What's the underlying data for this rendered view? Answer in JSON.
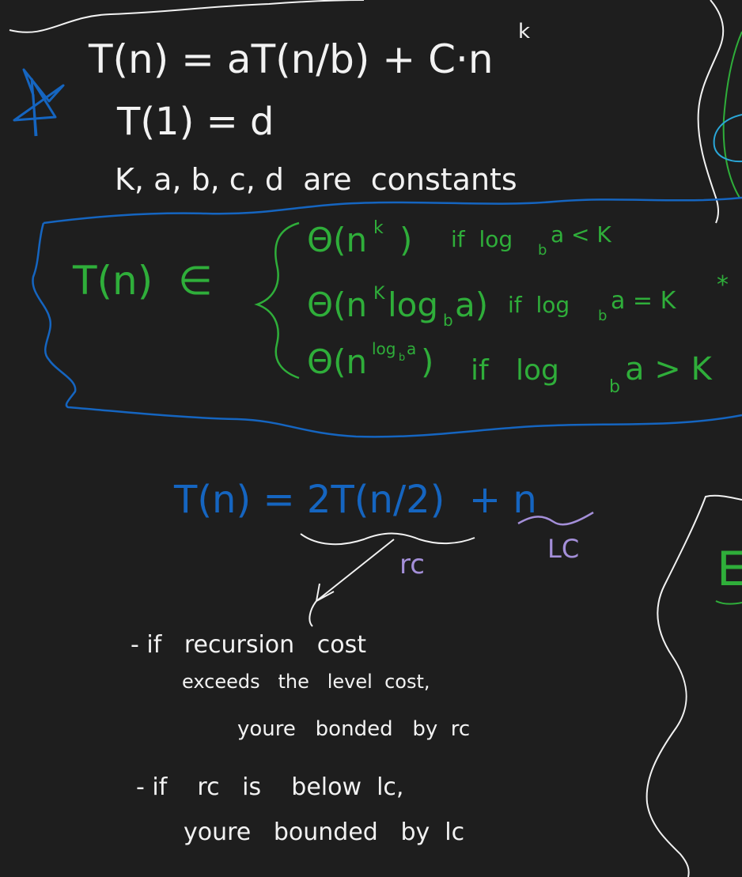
{
  "colors": {
    "background": "#1e1e1e",
    "white_ink": "#f2f2f2",
    "green_ink": "#2fae3a",
    "blue_ink": "#1565c0",
    "purple_ink": "#a48fd9",
    "cyan_ink": "#2aa7d8"
  },
  "recurrence": {
    "general": "T(n) = aT(n/b) + C·n",
    "general_exp": "k",
    "base": "T(1) = d",
    "constants": "K, a, b, c, d  are  constants"
  },
  "theorem": {
    "lhs": "T(n)  ∈",
    "cases": [
      {
        "theta": "Θ(n",
        "sup": "k",
        "tail": ")",
        "cond": "if  log",
        "cond_sub": "b",
        "cond_tail": "a < K"
      },
      {
        "theta": "Θ(n",
        "sup": "K",
        "tail": "log",
        "tail_sub": "b",
        "tail_end": "a)",
        "cond": "if  log",
        "cond_sub": "b",
        "cond_tail": "a = K",
        "mark": "*"
      },
      {
        "theta": "Θ(n",
        "sup": "log",
        "sup_sub": "b",
        "sup_end": "a",
        "tail": ")",
        "cond": "if   log",
        "cond_sub": "b",
        "cond_tail": "a > K"
      }
    ]
  },
  "example": {
    "equation": "T(n) = 2T(n/2)  + n",
    "rc_label": "rc",
    "lc_label": "LC"
  },
  "notes": {
    "line1": "- if   recursion   cost",
    "line2": "exceeds   the   level  cost,",
    "line3": "youre   bonded   by  rc",
    "line4": "- if    rc   is    below  lc,",
    "line5": "youre   bounded   by  lc"
  },
  "right_partial": {
    "letter": "E"
  }
}
